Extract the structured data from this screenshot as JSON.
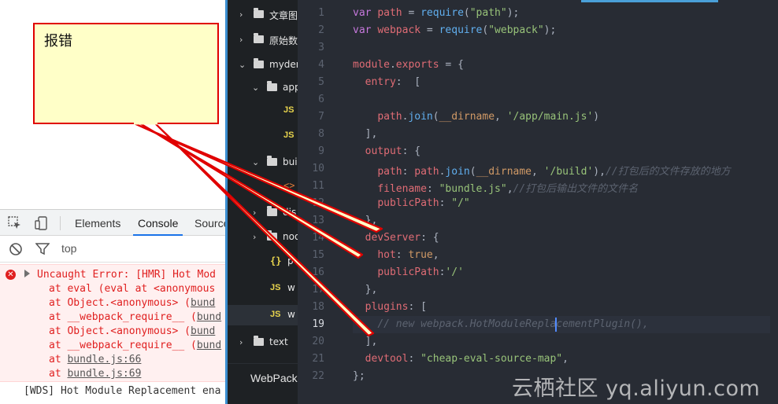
{
  "annotation": {
    "text": "报错"
  },
  "devtools": {
    "tabs": [
      "Elements",
      "Console",
      "Source"
    ],
    "active_tab": "Console",
    "context": "top",
    "error": {
      "message": "Uncaught Error: [HMR] Hot Mod",
      "frames": [
        {
          "prefix": "at eval (eval at <anonymous",
          "link": ""
        },
        {
          "prefix": "at Object.<anonymous> (",
          "link": "bund"
        },
        {
          "prefix": "at __webpack_require__ (",
          "link": "bund"
        },
        {
          "prefix": "at Object.<anonymous> (",
          "link": "bund"
        },
        {
          "prefix": "at __webpack_require__ (",
          "link": "bund"
        },
        {
          "prefix": "at ",
          "link": "bundle.js:66"
        },
        {
          "prefix": "at ",
          "link": "bundle.js:69"
        }
      ]
    },
    "wds_message": "[WDS] Hot Module Replacement ena"
  },
  "explorer": {
    "items": [
      {
        "kind": "folder",
        "label": "文章图",
        "expanded": false
      },
      {
        "kind": "folder",
        "label": "原始数",
        "expanded": false
      },
      {
        "kind": "folder",
        "label": "myder",
        "expanded": true
      },
      {
        "kind": "folder",
        "label": "app",
        "expanded": true
      },
      {
        "kind": "js",
        "label": ""
      },
      {
        "kind": "js",
        "label": ""
      },
      {
        "kind": "folder",
        "label": "bui",
        "expanded": true
      },
      {
        "kind": "html",
        "label": ""
      },
      {
        "kind": "folder",
        "label": "dis",
        "expanded": false
      },
      {
        "kind": "folder",
        "label": "noo",
        "expanded": false
      },
      {
        "kind": "json",
        "label": "p"
      },
      {
        "kind": "js",
        "label": "w"
      },
      {
        "kind": "js",
        "label": "w"
      },
      {
        "kind": "folder",
        "label": "text",
        "expanded": false
      }
    ],
    "js_badge": "JS",
    "json_badge": "{}",
    "html_badge": "<>",
    "footer_title": "WebPack"
  },
  "editor": {
    "current_line": 19,
    "lines": [
      [
        [
          "kw",
          "var "
        ],
        [
          "var",
          "path"
        ],
        [
          "pl",
          " = "
        ],
        [
          "fn",
          "require"
        ],
        [
          "pl",
          "("
        ],
        [
          "str",
          "\"path\""
        ],
        [
          "pl",
          ");"
        ]
      ],
      [
        [
          "kw",
          "var "
        ],
        [
          "var",
          "webpack"
        ],
        [
          "pl",
          " = "
        ],
        [
          "fn",
          "require"
        ],
        [
          "pl",
          "("
        ],
        [
          "str",
          "\"webpack\""
        ],
        [
          "pl",
          ");"
        ]
      ],
      [],
      [
        [
          "var",
          "module"
        ],
        [
          "pl",
          "."
        ],
        [
          "var",
          "exports"
        ],
        [
          "pl",
          " = {"
        ]
      ],
      [
        [
          "pl",
          "  "
        ],
        [
          "var",
          "entry"
        ],
        [
          "pl",
          ":  ["
        ]
      ],
      [],
      [
        [
          "pl",
          "    "
        ],
        [
          "var",
          "path"
        ],
        [
          "pl",
          "."
        ],
        [
          "fn",
          "join"
        ],
        [
          "pl",
          "("
        ],
        [
          "cst",
          "__dirname"
        ],
        [
          "pl",
          ", "
        ],
        [
          "str",
          "'/app/main.js'"
        ],
        [
          "pl",
          ")"
        ]
      ],
      [
        [
          "pl",
          "  ],"
        ]
      ],
      [
        [
          "pl",
          "  "
        ],
        [
          "var",
          "output"
        ],
        [
          "pl",
          ": {"
        ]
      ],
      [
        [
          "pl",
          "    "
        ],
        [
          "var",
          "path"
        ],
        [
          "pl",
          ": "
        ],
        [
          "var",
          "path"
        ],
        [
          "pl",
          "."
        ],
        [
          "fn",
          "join"
        ],
        [
          "pl",
          "("
        ],
        [
          "cst",
          "__dirname"
        ],
        [
          "pl",
          ", "
        ],
        [
          "str",
          "'/build'"
        ],
        [
          "pl",
          "),"
        ],
        [
          "cm",
          "//打包后的文件存放的地方"
        ]
      ],
      [
        [
          "pl",
          "    "
        ],
        [
          "var",
          "filename"
        ],
        [
          "pl",
          ": "
        ],
        [
          "str",
          "\"bundle.js\""
        ],
        [
          "pl",
          ","
        ],
        [
          "cm",
          "//打包后输出文件的文件名"
        ]
      ],
      [
        [
          "pl",
          "    "
        ],
        [
          "var",
          "publicPath"
        ],
        [
          "pl",
          ": "
        ],
        [
          "str",
          "\"/\""
        ]
      ],
      [
        [
          "pl",
          "  },"
        ]
      ],
      [
        [
          "pl",
          "  "
        ],
        [
          "var",
          "devServer"
        ],
        [
          "pl",
          ": {"
        ]
      ],
      [
        [
          "pl",
          "    "
        ],
        [
          "var",
          "hot"
        ],
        [
          "pl",
          ": "
        ],
        [
          "cst",
          "true"
        ],
        [
          "pl",
          ","
        ]
      ],
      [
        [
          "pl",
          "    "
        ],
        [
          "var",
          "publicPath"
        ],
        [
          "pl",
          ":"
        ],
        [
          "str",
          "'/'"
        ]
      ],
      [
        [
          "pl",
          "  },"
        ]
      ],
      [
        [
          "pl",
          "  "
        ],
        [
          "var",
          "plugins"
        ],
        [
          "pl",
          ": ["
        ]
      ],
      [
        [
          "pl",
          "    "
        ],
        [
          "cm",
          "// new webpack.HotModuleReplacementPlugin(),"
        ]
      ],
      [
        [
          "pl",
          "  ],"
        ]
      ],
      [
        [
          "pl",
          "  "
        ],
        [
          "var",
          "devtool"
        ],
        [
          "pl",
          ": "
        ],
        [
          "str",
          "\"cheap-eval-source-map\""
        ],
        [
          "pl",
          ","
        ]
      ],
      [
        [
          "pl",
          "};"
        ]
      ]
    ]
  },
  "watermark": "云栖社区 yq.aliyun.com",
  "colors": {
    "error_red": "#e02020",
    "callout_fill": "#ffffc8",
    "callout_border": "#e00000",
    "editor_bg": "#282c34",
    "explorer_bg": "#1e2124"
  }
}
